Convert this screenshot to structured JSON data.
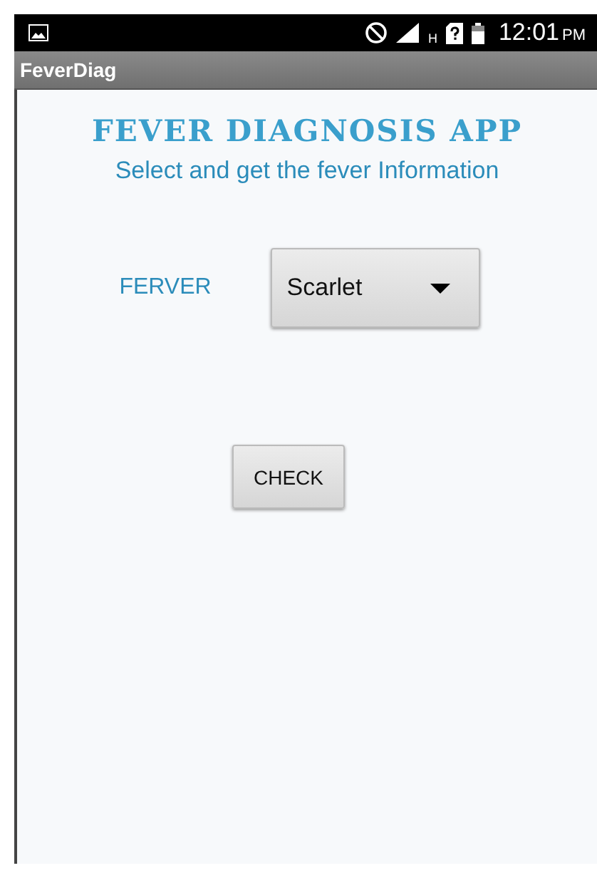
{
  "status_bar": {
    "network": "H",
    "time": "12:01",
    "meridiem": "PM"
  },
  "app_bar": {
    "title": "FeverDiag"
  },
  "header": {
    "title": "FEVER DIAGNOSIS APP",
    "subtitle": "Select and get the fever Information"
  },
  "form": {
    "label": "FERVER",
    "dropdown": {
      "value": "Scarlet"
    },
    "button": "CHECK"
  }
}
